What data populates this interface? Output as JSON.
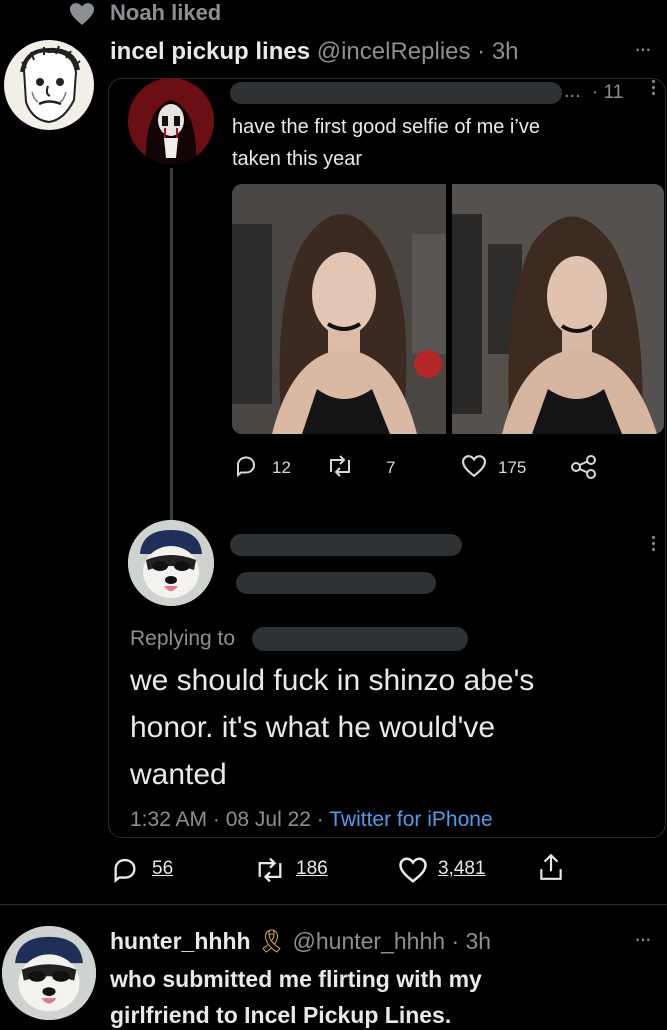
{
  "liked_by": {
    "text": "Noah liked"
  },
  "outer_tweet": {
    "display_name": "incel pickup lines",
    "handle": "@incelReplies",
    "time": "· 3h",
    "more": "···",
    "stats": {
      "replies": "56",
      "retweets": "186",
      "likes": "3,481"
    }
  },
  "quoted_tweet": {
    "top_post": {
      "ellipsis": "...",
      "time": "· 11",
      "text_line1": "have the first good selfie of me i’ve",
      "text_line2": "taken this year",
      "stats": {
        "replies": "12",
        "retweets": "7",
        "likes": "175"
      }
    },
    "reply": {
      "replying_to": "Replying to",
      "text_line1": "we should fuck in shinzo abe's",
      "text_line2": "honor. it's what he would've",
      "text_line3": "wanted",
      "time": "1:32 AM · 08 Jul 22 · ",
      "source": "Twitter for iPhone"
    }
  },
  "reply_tweet": {
    "display_name": "hunter_hhhh",
    "ribbon": "🎗",
    "handle": "@hunter_hhhh",
    "time": "· 3h",
    "more": "···",
    "text_line1": "who submitted me flirting with my",
    "text_line2": "girlfriend to Incel Pickup Lines."
  },
  "colors": {
    "background": "#000000",
    "text": "#e7e9ea",
    "muted": "#8b8f94",
    "link": "#4a9eea",
    "redaction": "#2f3235",
    "ribbon": "#e6b73c"
  }
}
